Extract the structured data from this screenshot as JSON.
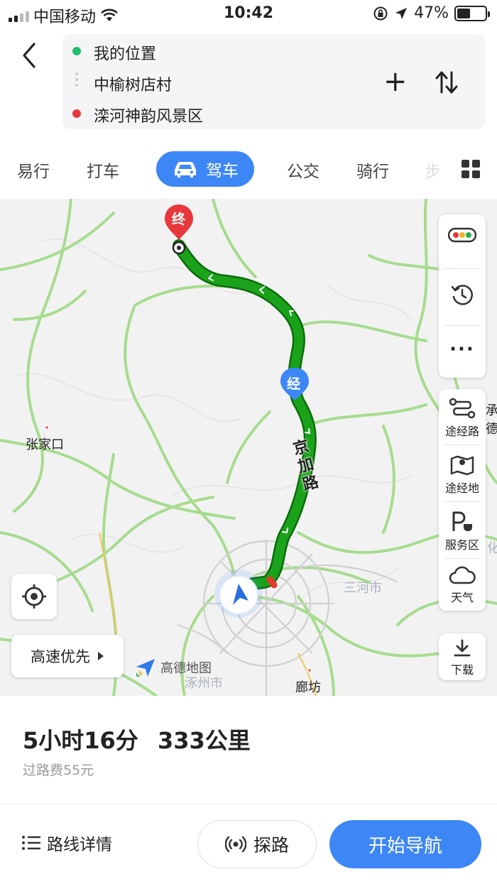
{
  "status_bar": {
    "carrier": "中国移动",
    "time": "10:42",
    "battery": "47%",
    "battery_level": 0.47
  },
  "route": {
    "start": "我的位置",
    "via": "中榆树店村",
    "end": "滦河神韵风景区",
    "start_color": "#1fbf6b",
    "end_color": "#e8383d"
  },
  "tabs": {
    "items": [
      "易行",
      "打车",
      "驾车",
      "公交",
      "骑行",
      "步"
    ],
    "active": "驾车",
    "accent": "#3d86f5"
  },
  "map": {
    "end_marker": "终",
    "via_marker": "经",
    "road_name": "京加路",
    "cities": [
      "张家口",
      "三河市",
      "涿州市",
      "廊坊"
    ],
    "partial_labels": [
      "承德",
      "化"
    ],
    "route_color": "#1aa31a",
    "logo_text": "高德地图"
  },
  "map_controls": {
    "waypoint_road": "途经路",
    "waypoint_place": "途经地",
    "service_area": "服务区",
    "weather": "天气",
    "download": "下载",
    "preference": "高速优先"
  },
  "summary": {
    "duration": "5小时16分",
    "distance": "333公里",
    "toll": "过路费55元"
  },
  "actions": {
    "details": "路线详情",
    "probe": "探路",
    "start_navigation": "开始导航"
  }
}
